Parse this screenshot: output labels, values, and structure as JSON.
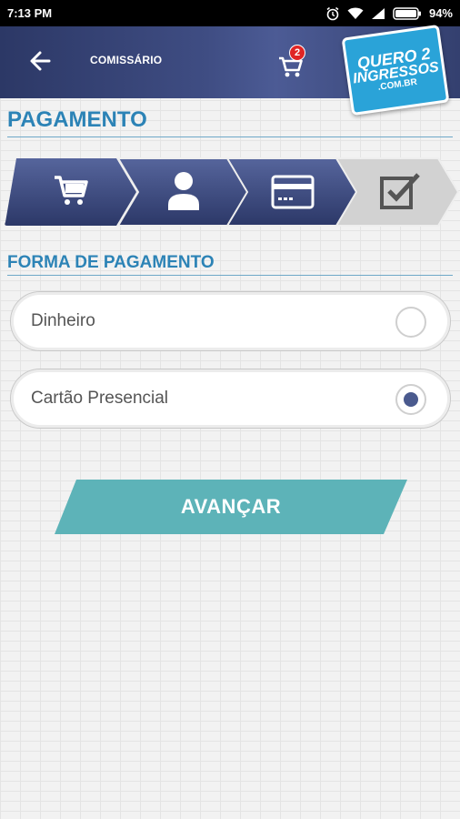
{
  "status_bar": {
    "time": "7:13 PM",
    "battery": "94%",
    "icons": [
      "alarm-icon",
      "wifi-icon",
      "signal-icon",
      "battery-icon"
    ]
  },
  "app_bar": {
    "back_icon": "arrow-left-icon",
    "title": "COMISSÁRIO",
    "cart_icon": "cart-icon",
    "cart_count": "2",
    "logo": {
      "line1": "QUERO 2",
      "line2": "INGRESSOS",
      "line3": ".COM.BR"
    }
  },
  "page": {
    "title": "PAGAMENTO",
    "steps": [
      {
        "icon": "cart-icon",
        "state": "done"
      },
      {
        "icon": "user-icon",
        "state": "done"
      },
      {
        "icon": "credit-card-icon",
        "state": "active"
      },
      {
        "icon": "checkbox-icon",
        "state": "pending"
      }
    ],
    "payment_section_title": "FORMA DE PAGAMENTO",
    "options": [
      {
        "label": "Dinheiro",
        "selected": false
      },
      {
        "label": "Cartão Presencial",
        "selected": true
      }
    ],
    "advance_button": "AVANÇAR"
  },
  "colors": {
    "header": "#3f4d83",
    "step_active": "#3b4a7e",
    "step_pending": "#cfcfcf",
    "title_blue": "#2c83b6",
    "button": "#5db3b8",
    "badge": "#e02424",
    "radio_dot": "#4a5a8e"
  }
}
